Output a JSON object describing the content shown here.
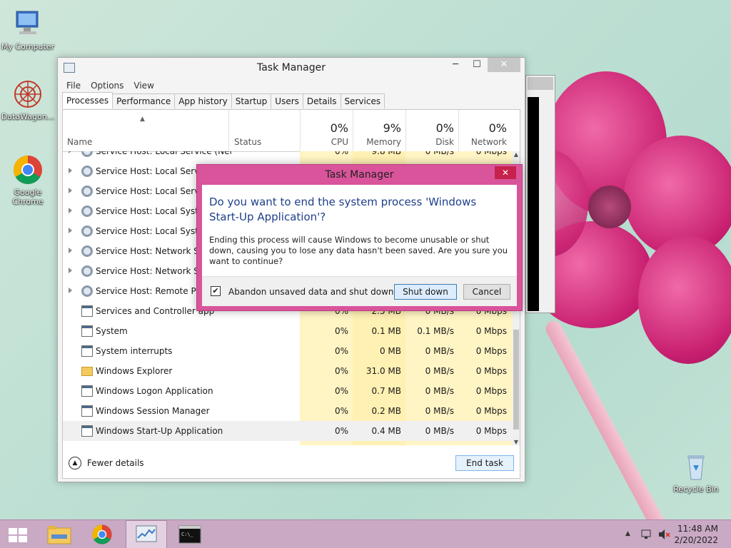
{
  "desktop": {
    "icons": [
      {
        "label": "My Computer"
      },
      {
        "label": "DataWagon..."
      },
      {
        "label": "Google Chrome"
      },
      {
        "label": "Recycle Bin"
      }
    ]
  },
  "task_manager": {
    "title": "Task Manager",
    "menu": [
      "File",
      "Options",
      "View"
    ],
    "tabs": [
      "Processes",
      "Performance",
      "App history",
      "Startup",
      "Users",
      "Details",
      "Services"
    ],
    "active_tab": "Processes",
    "columns": {
      "name": "Name",
      "status": "Status",
      "cpu": {
        "pct": "0%",
        "label": "CPU"
      },
      "memory": {
        "pct": "9%",
        "label": "Memory"
      },
      "disk": {
        "pct": "0%",
        "label": "Disk"
      },
      "network": {
        "pct": "0%",
        "label": "Network"
      }
    },
    "rows": [
      {
        "name": "Service Host: Local Service (Net...",
        "cpu": "0%",
        "memory": "9.8 MB",
        "disk": "0 MB/s",
        "network": "0 Mbps"
      },
      {
        "name": "Service Host: Local Service",
        "cpu": "",
        "memory": "",
        "disk": "",
        "network": ""
      },
      {
        "name": "Service Host: Local Service",
        "cpu": "",
        "memory": "",
        "disk": "",
        "network": ""
      },
      {
        "name": "Service Host: Local System",
        "cpu": "",
        "memory": "",
        "disk": "",
        "network": ""
      },
      {
        "name": "Service Host: Local System",
        "cpu": "",
        "memory": "",
        "disk": "",
        "network": ""
      },
      {
        "name": "Service Host: Network Serv",
        "cpu": "",
        "memory": "",
        "disk": "",
        "network": ""
      },
      {
        "name": "Service Host: Network Serv",
        "cpu": "",
        "memory": "",
        "disk": "",
        "network": ""
      },
      {
        "name": "Service Host: Remote Proc",
        "cpu": "",
        "memory": "",
        "disk": "",
        "network": ""
      },
      {
        "name": "Services and Controller app",
        "cpu": "0%",
        "memory": "2.5 MB",
        "disk": "0 MB/s",
        "network": "0 Mbps"
      },
      {
        "name": "System",
        "cpu": "0%",
        "memory": "0.1 MB",
        "disk": "0.1 MB/s",
        "network": "0 Mbps"
      },
      {
        "name": "System interrupts",
        "cpu": "0%",
        "memory": "0 MB",
        "disk": "0 MB/s",
        "network": "0 Mbps"
      },
      {
        "name": "Windows Explorer",
        "cpu": "0%",
        "memory": "31.0 MB",
        "disk": "0 MB/s",
        "network": "0 Mbps"
      },
      {
        "name": "Windows Logon Application",
        "cpu": "0%",
        "memory": "0.7 MB",
        "disk": "0 MB/s",
        "network": "0 Mbps"
      },
      {
        "name": "Windows Session Manager",
        "cpu": "0%",
        "memory": "0.2 MB",
        "disk": "0 MB/s",
        "network": "0 Mbps"
      },
      {
        "name": "Windows Start-Up Application",
        "cpu": "0%",
        "memory": "0.4 MB",
        "disk": "0 MB/s",
        "network": "0 Mbps"
      }
    ],
    "fewer_details": "Fewer details",
    "end_task": "End task"
  },
  "dialog": {
    "title": "Task Manager",
    "close": "✕",
    "question": "Do you want to end the system process 'Windows Start-Up Application'?",
    "message": "Ending this process will cause Windows to become unusable or shut down, causing you to lose any data hasn't been saved. Are you sure you want to continue?",
    "checkbox_label": "Abandon unsaved data and shut down.",
    "checkbox_checked": true,
    "shutdown": "Shut down",
    "cancel": "Cancel"
  },
  "taskbar": {
    "time": "11:48 AM",
    "date": "2/20/2022"
  },
  "colors": {
    "dialog_frame": "#d9549b",
    "heat": "#fff4c4",
    "taskbar": "#c9a9c4"
  }
}
